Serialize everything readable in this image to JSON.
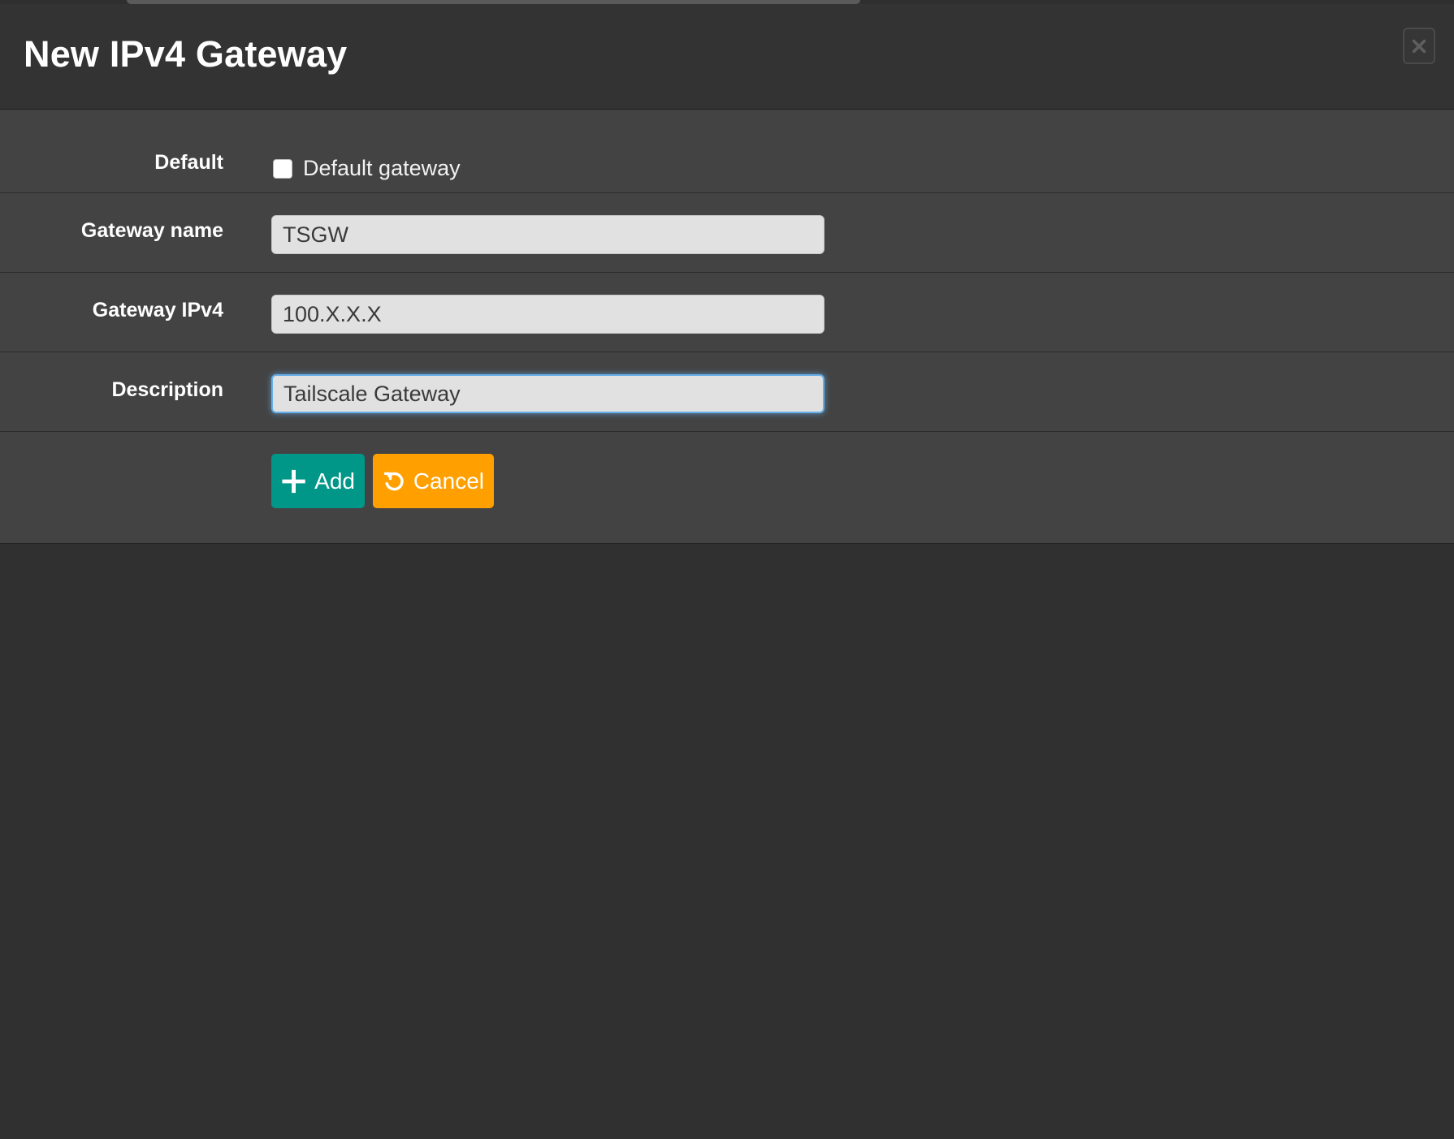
{
  "modal": {
    "title": "New IPv4 Gateway",
    "close_icon": "close-icon"
  },
  "form": {
    "default": {
      "label": "Default",
      "checkbox_label": "Default gateway",
      "checked": false
    },
    "gateway_name": {
      "label": "Gateway name",
      "value": "TSGW"
    },
    "gateway_ipv4": {
      "label": "Gateway IPv4",
      "value": "100.X.X.X"
    },
    "description": {
      "label": "Description",
      "value": "Tailscale Gateway"
    }
  },
  "actions": {
    "add_label": "Add",
    "add_icon": "plus-icon",
    "cancel_label": "Cancel",
    "cancel_icon": "undo-icon"
  },
  "colors": {
    "add_button": "#009688",
    "cancel_button": "#ff9f00",
    "focus_ring": "#66afe9"
  }
}
